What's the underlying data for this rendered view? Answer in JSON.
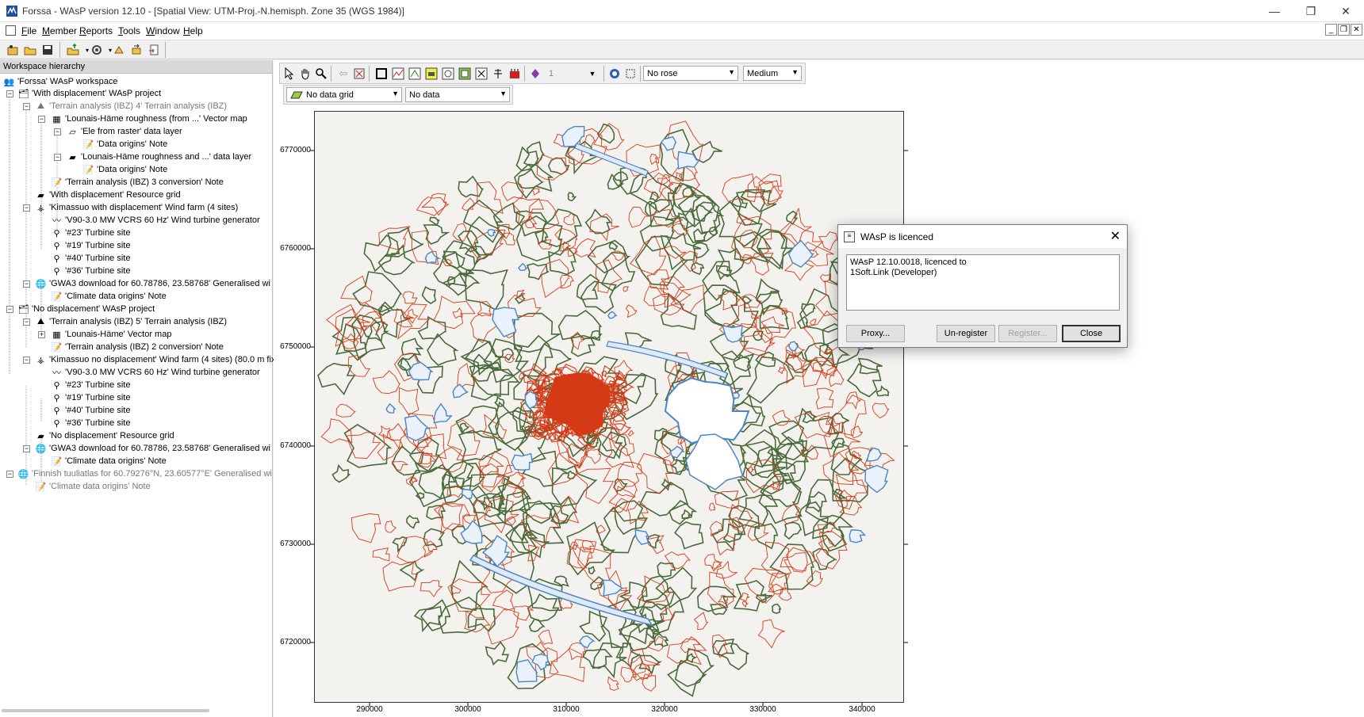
{
  "window": {
    "title": "Forssa - WAsP version 12.10 - [Spatial View: UTM-Proj.-N.hemisph. Zone 35 (WGS 1984)]",
    "min": "—",
    "max": "❐",
    "close": "✕"
  },
  "menu": {
    "items": [
      {
        "ul": "F",
        "rest": "ile"
      },
      {
        "ul": "M",
        "rest": "ember"
      },
      {
        "ul": "R",
        "rest": "eports"
      },
      {
        "ul": "T",
        "rest": "ools"
      },
      {
        "ul": "W",
        "rest": "indow"
      },
      {
        "ul": "H",
        "rest": "elp"
      }
    ],
    "mdi_min": "_",
    "mdi_restore": "❐",
    "mdi_close": "✕"
  },
  "workspace": {
    "header": "Workspace hierarchy",
    "tree": [
      {
        "label": "'Forssa' WAsP workspace"
      },
      {
        "label": "'With displacement' WAsP project"
      },
      {
        "label": "'Terrain analysis (IBZ) 4' Terrain analysis (IBZ)"
      },
      {
        "label": "'Lounais-Häme roughness (from ...' Vector map"
      },
      {
        "label": "'Ele from raster' data layer"
      },
      {
        "label": "'Data origins' Note"
      },
      {
        "label": "'Lounais-Häme roughness and ...' data layer"
      },
      {
        "label": "'Data origins' Note"
      },
      {
        "label": "'Terrain analysis (IBZ) 3 conversion' Note"
      },
      {
        "label": "'With displacement' Resource grid"
      },
      {
        "label": "'Kimassuo with displacement' Wind farm (4 sites)"
      },
      {
        "label": "'V90-3.0 MW VCRS 60 Hz' Wind turbine generator"
      },
      {
        "label": "'#23' Turbine site"
      },
      {
        "label": "'#19' Turbine site"
      },
      {
        "label": "'#40' Turbine site"
      },
      {
        "label": "'#36' Turbine site"
      },
      {
        "label": "'GWA3 download for 60.78786, 23.58768' Generalised wi"
      },
      {
        "label": "'Climate data origins' Note"
      },
      {
        "label": "'No displacement' WAsP project"
      },
      {
        "label": "'Terrain analysis (IBZ) 5' Terrain analysis (IBZ)"
      },
      {
        "label": "'Lounais-Häme' Vector map"
      },
      {
        "label": "'Terrain analysis (IBZ) 2 conversion' Note"
      },
      {
        "label": "'Kimassuo no displacement' Wind farm (4 sites) (80.0 m fix"
      },
      {
        "label": "'V90-3.0 MW VCRS 60 Hz' Wind turbine generator"
      },
      {
        "label": "'#23' Turbine site"
      },
      {
        "label": "'#19' Turbine site"
      },
      {
        "label": "'#40' Turbine site"
      },
      {
        "label": "'#36' Turbine site"
      },
      {
        "label": "'No displacement' Resource grid"
      },
      {
        "label": "'GWA3 download for 60.78786, 23.58768' Generalised wi"
      },
      {
        "label": "'Climate data origins' Note"
      },
      {
        "label": "'Finnish tuuliatlas for 60.79276°N, 23.60577°E' Generalised wi"
      },
      {
        "label": "'Climate data origins' Note"
      }
    ]
  },
  "map_toolbar": {
    "layer_number": "1",
    "rose": "No rose",
    "size": "Medium",
    "grid": "No data grid",
    "data": "No data"
  },
  "map": {
    "y_ticks": [
      "6770000",
      "6760000",
      "6750000",
      "6740000",
      "6730000",
      "6720000"
    ],
    "x_ticks": [
      "290000",
      "300000",
      "310000",
      "320000",
      "330000",
      "340000"
    ],
    "colors": {
      "roughness": "#4a6b3a",
      "elevation": "#d43a16",
      "water": "#4a86c8"
    }
  },
  "dialog": {
    "title": "WAsP is licenced",
    "line1": "WAsP 12.10.0018, licenced to",
    "line2": "1Soft.Link (Developer)",
    "proxy": "Proxy...",
    "unregister": "Un-register",
    "register": "Register...",
    "close": "Close"
  }
}
